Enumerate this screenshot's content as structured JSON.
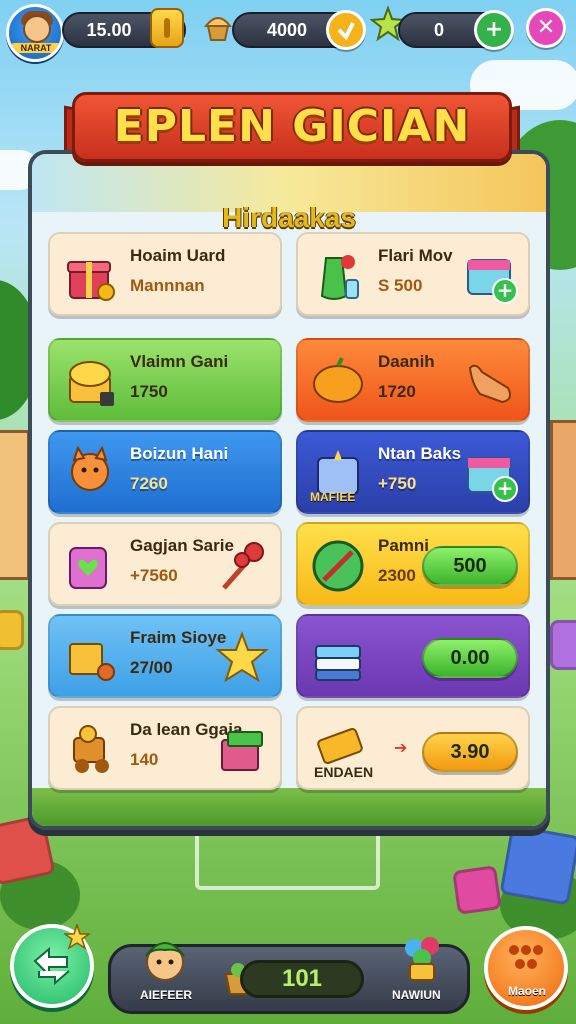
{
  "topbar": {
    "avatar_name": "NARAT",
    "currency1_value": "15.00",
    "currency2_value": "4000",
    "currency3_value": "0"
  },
  "banner": {
    "title": "EPLEN GICIAN"
  },
  "panel": {
    "subtitle": "Hirdaakas"
  },
  "cards": [
    {
      "title": "Hoaim Uard",
      "sub": "Mannnan",
      "color": "cream"
    },
    {
      "title": "Flari Mov",
      "sub": "S 500",
      "color": "cream"
    },
    {
      "title": "Vlaimn Gani",
      "sub": "1750",
      "color": "green"
    },
    {
      "title": "Daanih",
      "sub": "1720",
      "color": "orange"
    },
    {
      "title": "Boizun Hani",
      "sub": "7260",
      "color": "blue"
    },
    {
      "title": "Ntan Baks",
      "sub": "+750",
      "badge": "MAFIEE",
      "color": "navy"
    },
    {
      "title": "Gagjan Sarie",
      "sub": "+7560",
      "color": "cream"
    },
    {
      "title": "Pamni",
      "sub": "2300",
      "price": "500",
      "color": "yellow"
    },
    {
      "title": "Fraim Sioye",
      "sub": "27/00",
      "color": "skyblue"
    },
    {
      "title": "",
      "sub": "",
      "price": "0.00",
      "color": "purple"
    },
    {
      "title": "Da lean Ggaia",
      "sub": "140",
      "color": "cream"
    },
    {
      "title": "ENDAEN",
      "sub": "",
      "price": "3.90",
      "color": "cream"
    }
  ],
  "bottombar": {
    "left_label": "AIEFEER",
    "counter_value": "101",
    "right_label": "NAWIUN",
    "orb_label": "Maoen"
  },
  "colors": {
    "banner": "#e04425",
    "panel_border": "#3d4a57",
    "green_button": "#3bb42c",
    "orange_button": "#f29a10"
  }
}
